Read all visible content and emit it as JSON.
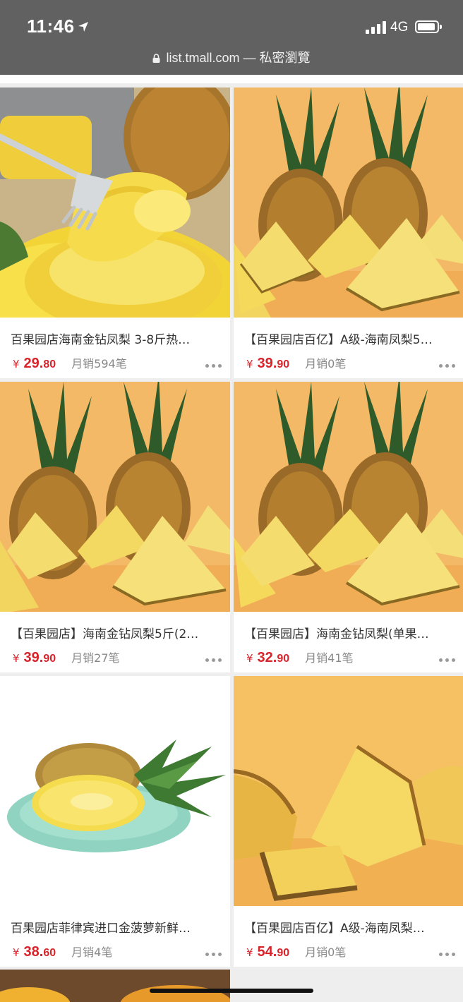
{
  "status_bar": {
    "time": "11:46",
    "network": "4G",
    "url": "list.tmall.com — 私密瀏覽"
  },
  "products": [
    {
      "title": "百果园店海南金钻凤梨 3-8斤热…",
      "currency": "¥",
      "price_int": "29.",
      "price_dec": "80",
      "sales": "月销594笔",
      "image": "pineapple-rings-fork"
    },
    {
      "title": "【百果园店百亿】A级-海南凤梨5…",
      "currency": "¥",
      "price_int": "39.",
      "price_dec": "90",
      "sales": "月销0笔",
      "image": "pineapple-wedges"
    },
    {
      "title": "【百果园店】海南金钻凤梨5斤(2…",
      "currency": "¥",
      "price_int": "39.",
      "price_dec": "90",
      "sales": "月销27笔",
      "image": "pineapple-wedges"
    },
    {
      "title": "【百果园店】海南金钻凤梨(单果…",
      "currency": "¥",
      "price_int": "32.",
      "price_dec": "90",
      "sales": "月销41笔",
      "image": "pineapple-wedges"
    },
    {
      "title": "百果园店菲律宾进口金菠萝新鲜…",
      "currency": "¥",
      "price_int": "38.",
      "price_dec": "60",
      "sales": "月销4笔",
      "image": "pineapple-half-plate"
    },
    {
      "title": "【百果园店百亿】A级-海南凤梨…",
      "currency": "¥",
      "price_int": "54.",
      "price_dec": "90",
      "sales": "月销0笔",
      "image": "pineapple-slice-closeup"
    }
  ],
  "colors": {
    "price": "#d8232a",
    "status_bar": "#616161"
  }
}
